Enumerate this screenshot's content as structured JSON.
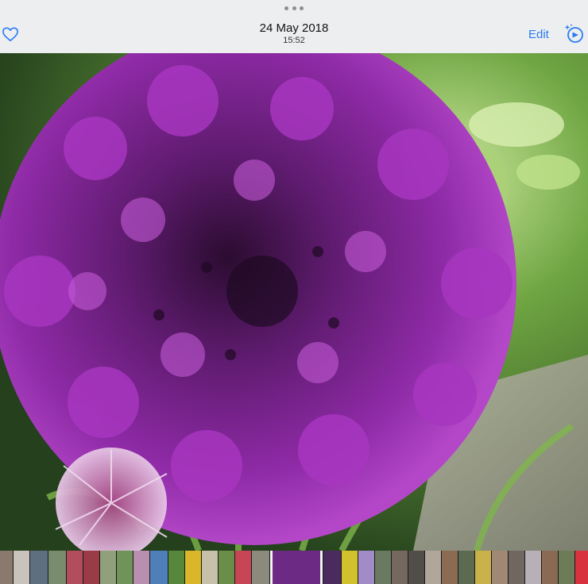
{
  "header": {
    "date": "24 May 2018",
    "time": "15:52",
    "edit_label": "Edit",
    "icons": {
      "favorite": "heart-icon",
      "grabber": "more-dots-icon",
      "live_photo": "live-photo-magic-icon"
    },
    "accent_color": "#2a7bf4"
  },
  "photo": {
    "subject": "purple allium flower head"
  },
  "filmstrip": {
    "selected_index": 16,
    "thumbnails": [
      {
        "color": "#8a7a6e",
        "w": 16
      },
      {
        "color": "#c8c4bb",
        "w": 20
      },
      {
        "color": "#5d6f80",
        "w": 22
      },
      {
        "color": "#7a8c6e",
        "w": 22
      },
      {
        "color": "#b14d5c",
        "w": 20
      },
      {
        "color": "#9a3b47",
        "w": 20
      },
      {
        "color": "#8fa07a",
        "w": 20
      },
      {
        "color": "#6f9358",
        "w": 20
      },
      {
        "color": "#b98fb0",
        "w": 20
      },
      {
        "color": "#4f7fb8",
        "w": 22
      },
      {
        "color": "#57873b",
        "w": 20
      },
      {
        "color": "#d9b62a",
        "w": 20
      },
      {
        "color": "#c6c1a8",
        "w": 20
      },
      {
        "color": "#6a8e4a",
        "w": 20
      },
      {
        "color": "#c84556",
        "w": 20
      },
      {
        "color": "#8c8a7d",
        "w": 22
      },
      {
        "color": "#6d2a85",
        "w": 60
      },
      {
        "color": "#4b2a5e",
        "w": 22
      },
      {
        "color": "#d1c12d",
        "w": 20
      },
      {
        "color": "#a18cc8",
        "w": 20
      },
      {
        "color": "#6a7a60",
        "w": 20
      },
      {
        "color": "#74685f",
        "w": 20
      },
      {
        "color": "#514d48",
        "w": 20
      },
      {
        "color": "#b0a79a",
        "w": 20
      },
      {
        "color": "#8b6c52",
        "w": 20
      },
      {
        "color": "#5c6a52",
        "w": 20
      },
      {
        "color": "#c9b24a",
        "w": 20
      },
      {
        "color": "#a08874",
        "w": 20
      },
      {
        "color": "#706860",
        "w": 20
      },
      {
        "color": "#b7b0b6",
        "w": 20
      },
      {
        "color": "#8a6a52",
        "w": 20
      },
      {
        "color": "#6c7c58",
        "w": 20
      },
      {
        "color": "#d8323e",
        "w": 20
      }
    ]
  }
}
